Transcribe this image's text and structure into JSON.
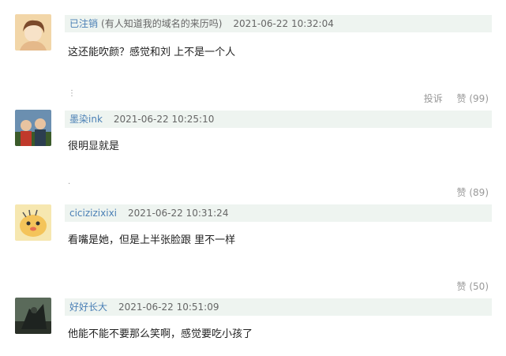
{
  "comments": [
    {
      "user": "已注销",
      "extra": "(有人知道我的域名的来历吗)",
      "time": "2021-06-22 10:32:04",
      "text": "这还能吹颜？感觉和刘     上不是一个人",
      "report": "投诉",
      "like": "赞 (99)",
      "avatar_colors": [
        "#f2d6a8",
        "#7b4a2c"
      ]
    },
    {
      "user": "墨染ink",
      "extra": "",
      "time": "2021-06-22 10:25:10",
      "text": "很明显就是",
      "report": "",
      "like": "赞 (89)",
      "avatar_colors": [
        "#6b8fb0",
        "#3b5a2a"
      ]
    },
    {
      "user": "cicizizixixi",
      "extra": "",
      "time": "2021-06-22 10:31:24",
      "text": "看嘴是她，但是上半张脸跟     里不一样",
      "report": "",
      "like": "赞 (50)",
      "avatar_colors": [
        "#f6e7b0",
        "#e8b04a"
      ]
    },
    {
      "user": "好好长大",
      "extra": "",
      "time": "2021-06-22 10:51:09",
      "text": "他能不能不要那么笑啊，感觉要吃小孩了",
      "report": "",
      "like": "",
      "avatar_colors": [
        "#5a6a5a",
        "#1e2320"
      ]
    }
  ],
  "colors": {
    "meta_bg": "#eef4f0",
    "username": "#4a7fb5",
    "action": "#999999"
  }
}
